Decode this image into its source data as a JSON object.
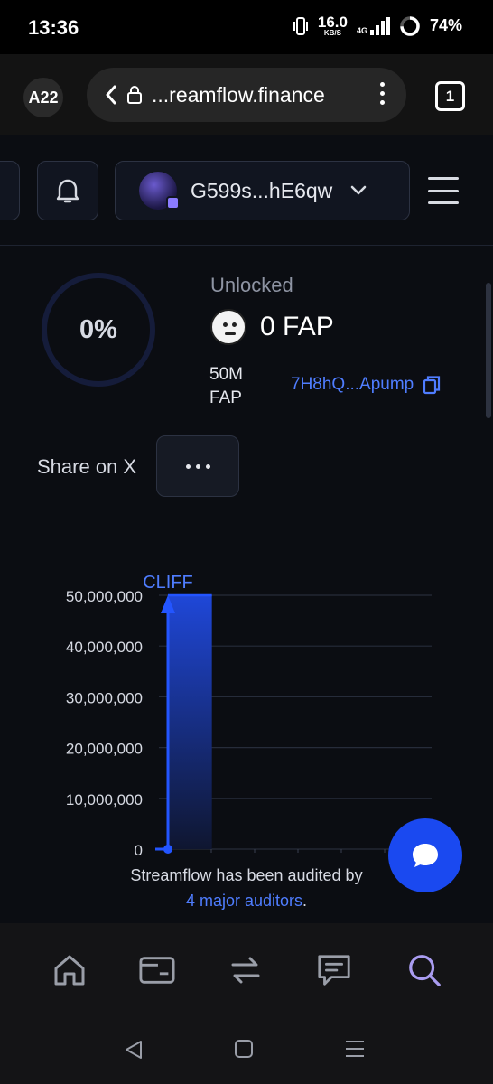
{
  "status_bar": {
    "time": "13:36",
    "net_speed": "16.0",
    "net_unit": "KB/S",
    "network": "4G",
    "battery": "74%",
    "icons": [
      "vibrate-icon",
      "signal-icon",
      "battery-ring-icon"
    ]
  },
  "browser": {
    "profile_label": "A22",
    "url": "...reamflow.finance",
    "tab_count": "1"
  },
  "header": {
    "wallet_address": "G599s...hE6qw"
  },
  "stream": {
    "progress_percent": 0,
    "progress_label": "0%",
    "unlocked_label": "Unlocked",
    "unlocked_amount": "0 FAP",
    "total_amount": "50M",
    "total_token": "FAP",
    "mint_address": "7H8hQ...Apump"
  },
  "share": {
    "label": "Share on X"
  },
  "chart_data": {
    "type": "area",
    "annotation": "CLIFF",
    "y_ticks": [
      "50,000,000",
      "40,000,000",
      "30,000,000",
      "20,000,000",
      "10,000,000",
      "0"
    ],
    "ylim": [
      0,
      50000000
    ],
    "grid": true,
    "series": [
      {
        "points": [
          {
            "x": 0,
            "y": 0
          },
          {
            "x": 0,
            "y": 50000000
          },
          {
            "x": 1,
            "y": 50000000
          }
        ],
        "color": "#2355ff"
      }
    ]
  },
  "audit": {
    "text": "Streamflow has been audited by",
    "link": "4 major auditors",
    "suffix": "."
  },
  "bottom_nav": {
    "items": [
      "home-icon",
      "wallet-icon",
      "swap-icon",
      "chat-icon",
      "search-icon"
    ],
    "active": "search-icon",
    "active_color": "#a99cf0"
  },
  "colors": {
    "accent": "#4f7dff",
    "fab": "#1a49f0",
    "background": "#0b0d12"
  }
}
